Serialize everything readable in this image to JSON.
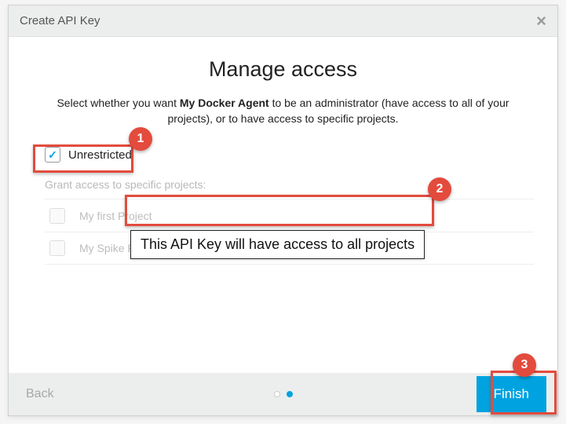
{
  "header": {
    "title": "Create API Key"
  },
  "body": {
    "heading": "Manage access",
    "sub_pre": "Select whether you want ",
    "sub_bold": "My Docker Agent",
    "sub_post": " to be an administrator (have access to all of your projects), or to have access to specific projects.",
    "unrestricted_label": "Unrestricted",
    "grant_label": "Grant access to specific projects:",
    "projects": [
      "My first Project",
      "My Spike For Test Recorder"
    ],
    "overlay_text": "This API Key will have access to all projects"
  },
  "footer": {
    "back": "Back",
    "finish": "Finish"
  },
  "annotations": [
    "1",
    "2",
    "3"
  ]
}
